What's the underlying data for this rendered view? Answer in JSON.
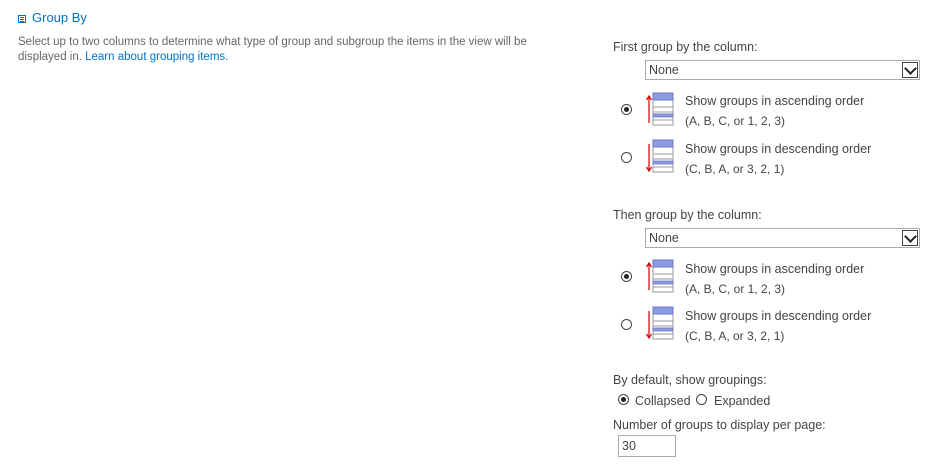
{
  "section": {
    "title": "Group By",
    "description": "Select up to two columns to determine what type of group and subgroup the items in the view will be displayed in.",
    "link_text": "Learn about grouping items."
  },
  "first_group": {
    "label": "First group by the column:",
    "selected": "None",
    "ascending": {
      "line1": "Show groups in ascending order",
      "line2": "(A, B, C, or 1, 2, 3)",
      "checked": true
    },
    "descending": {
      "line1": "Show groups in descending order",
      "line2": "(C, B, A, or 3, 2, 1)",
      "checked": false
    }
  },
  "then_group": {
    "label": "Then group by the column:",
    "selected": "None",
    "ascending": {
      "line1": "Show groups in ascending order",
      "line2": "(A, B, C, or 1, 2, 3)",
      "checked": true
    },
    "descending": {
      "line1": "Show groups in descending order",
      "line2": "(C, B, A, or 3, 2, 1)",
      "checked": false
    }
  },
  "default_groupings": {
    "label": "By default, show groupings:",
    "collapsed_label": "Collapsed",
    "expanded_label": "Expanded",
    "selected": "Collapsed"
  },
  "groups_per_page": {
    "label": "Number of groups to display per page:",
    "value": "30"
  },
  "colors": {
    "link": "#0072c6",
    "text": "#444444",
    "icon_header": "#7f8fd6",
    "arrow": "#cc0000"
  }
}
